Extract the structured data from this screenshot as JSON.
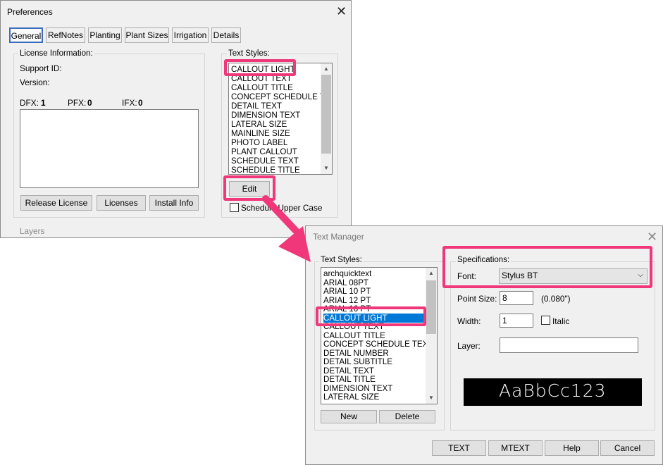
{
  "preferences": {
    "title": "Preferences",
    "close_glyph": "✕",
    "tabs": [
      "General",
      "RefNotes",
      "Planting",
      "Plant Sizes",
      "Irrigation",
      "Details"
    ],
    "license": {
      "group_label": "License Information:",
      "support_id_label": "Support ID:",
      "version_label": "Version:",
      "dfx_label": "DFX:",
      "dfx_value": "1",
      "pfx_label": "PFX:",
      "pfx_value": "0",
      "ifx_label": "IFX:",
      "ifx_value": "0",
      "buttons": [
        "Release License",
        "Licenses",
        "Install Info"
      ]
    },
    "text_styles": {
      "label": "Text Styles:",
      "items": [
        "CALLOUT LIGHT",
        "CALLOUT TEXT",
        "CALLOUT TITLE",
        "CONCEPT SCHEDULE TE",
        "DETAIL TEXT",
        "DIMENSION TEXT",
        "LATERAL SIZE",
        "MAINLINE SIZE",
        "PHOTO LABEL",
        "PLANT CALLOUT",
        "SCHEDULE TEXT",
        "SCHEDULE TITLE"
      ],
      "edit_button": "Edit",
      "checkbox_label": "Schedule Upper Case"
    },
    "layers_label": "Layers"
  },
  "text_manager": {
    "title": "Text Manager",
    "close_glyph": "✕",
    "styles_label": "Text Styles:",
    "styles": [
      "archquicktext",
      "ARIAL 08PT",
      "ARIAL 10 PT",
      "ARIAL 12 PT",
      "ARIAL 16 PT",
      "CALLOUT LIGHT",
      "CALLOUT TEXT",
      "CALLOUT TITLE",
      "CONCEPT SCHEDULE TEXT",
      "DETAIL NUMBER",
      "DETAIL SUBTITLE",
      "DETAIL TEXT",
      "DETAIL TITLE",
      "DIMENSION TEXT",
      "LATERAL SIZE"
    ],
    "selected_style": "CALLOUT LIGHT",
    "new_button": "New",
    "delete_button": "Delete",
    "specs": {
      "group_label": "Specifications:",
      "font_label": "Font:",
      "font_value": "Stylus BT",
      "point_size_label": "Point Size:",
      "point_size_value": "8",
      "point_size_inches": "(0.080\")",
      "width_label": "Width:",
      "width_value": "1",
      "italic_label": "Italic",
      "layer_label": "Layer:",
      "layer_value": ""
    },
    "preview_text": "AaBbCc123",
    "footer_buttons": [
      "TEXT",
      "MTEXT",
      "Help",
      "Cancel"
    ]
  },
  "colors": {
    "highlight": "#f0377a",
    "selection": "#0078d7",
    "preview_bg": "#000000"
  }
}
